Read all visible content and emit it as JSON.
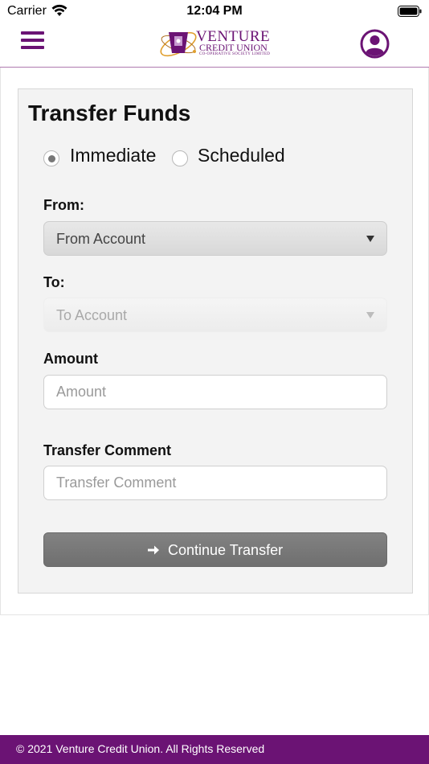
{
  "status_bar": {
    "carrier": "Carrier",
    "time": "12:04 PM",
    "icons": [
      "wifi-icon",
      "battery-icon"
    ]
  },
  "header": {
    "menu_icon": "hamburger-menu-icon",
    "logo": {
      "title": "VENTURE",
      "subtitle": "CREDIT UNION",
      "tagline": "CO-OPERATIVE SOCIETY LIMITED"
    },
    "profile_icon": "user-profile-icon",
    "accent_color": "#6b1374"
  },
  "form": {
    "title": "Transfer Funds",
    "transfer_type": {
      "options": [
        "Immediate",
        "Scheduled"
      ],
      "selected": "Immediate"
    },
    "from": {
      "label": "From:",
      "value": "From Account"
    },
    "to": {
      "label": "To:",
      "value": "To Account",
      "disabled": true
    },
    "amount": {
      "label": "Amount",
      "value": "",
      "placeholder": "Amount"
    },
    "comment": {
      "label": "Transfer Comment",
      "value": "",
      "placeholder": "Transfer Comment"
    },
    "submit": {
      "label": "Continue Transfer",
      "icon": "arrow-right-icon"
    }
  },
  "footer": {
    "text": "© 2021 Venture Credit Union. All Rights Reserved",
    "background_color": "#6b1374"
  }
}
